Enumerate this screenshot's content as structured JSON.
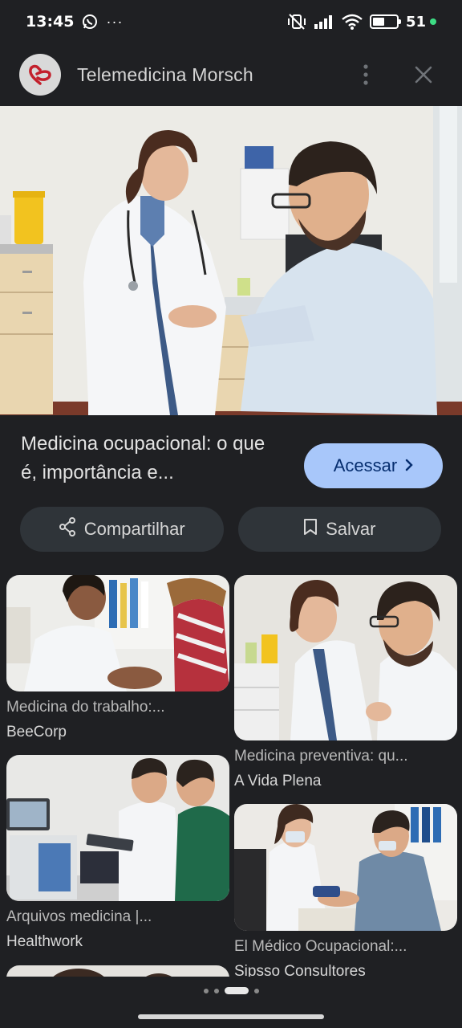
{
  "status_bar": {
    "time": "13:45",
    "notification_icons": [
      "whatsapp-icon",
      "more-dots"
    ],
    "more_indicator": "···",
    "battery_percent": "51",
    "battery_level": 0.51,
    "charging_color": "#3ddc84"
  },
  "header": {
    "site_name": "Telemedicina Morsch"
  },
  "result": {
    "title": "Medicina ocupacional: o que é, importância e...",
    "visit_label": "Acessar",
    "share_label": "Compartilhar",
    "save_label": "Salvar"
  },
  "related": [
    {
      "title": "Medicina do trabalho:...",
      "source": "BeeCorp"
    },
    {
      "title": "Medicina preventiva: qu...",
      "source": "A Vida Plena"
    },
    {
      "title": "Arquivos medicina |...",
      "source": "Healthwork"
    },
    {
      "title": "El Médico Ocupacional:...",
      "source": "Sipsso Consultores"
    }
  ],
  "pager": {
    "count": 4,
    "active_index": 2
  },
  "colors": {
    "background": "#1f2023",
    "primary_button": "#a8c7fa",
    "primary_button_text": "#062e6f",
    "pill": "#2f3439"
  }
}
